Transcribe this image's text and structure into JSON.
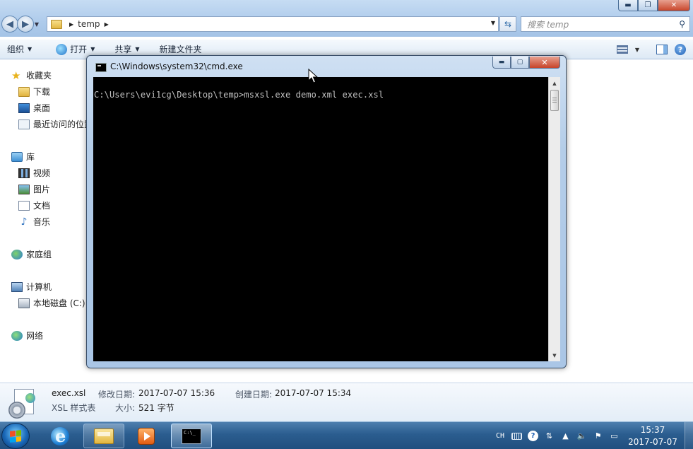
{
  "explorer": {
    "address": {
      "segments": [
        "temp"
      ]
    },
    "search": {
      "placeholder": "搜索 temp"
    },
    "toolbar": {
      "organize": "组织",
      "open": "打开",
      "share": "共享",
      "new_folder": "新建文件夹"
    },
    "sidebar": {
      "favorites": {
        "label": "收藏夹",
        "items": [
          "下载",
          "桌面",
          "最近访问的位置"
        ]
      },
      "libraries": {
        "label": "库",
        "items": [
          "视频",
          "图片",
          "文档",
          "音乐"
        ]
      },
      "homegroup": "家庭组",
      "computer": {
        "label": "计算机",
        "items": [
          "本地磁盘 (C:)"
        ]
      },
      "network": "网络"
    },
    "details": {
      "filename": "exec.xsl",
      "filetype": "XSL 样式表",
      "modified_label": "修改日期:",
      "modified_value": "2017-07-07 15:36",
      "created_label": "创建日期:",
      "created_value": "2017-07-07 15:34",
      "size_label": "大小:",
      "size_value": "521 字节"
    }
  },
  "cmd": {
    "title": "C:\\Windows\\system32\\cmd.exe",
    "command_line": "C:\\Users\\evi1cg\\Desktop\\temp>msxsl.exe demo.xml exec.xsl"
  },
  "taskbar": {
    "language": "CH",
    "time": "15:37",
    "date": "2017-07-07"
  }
}
